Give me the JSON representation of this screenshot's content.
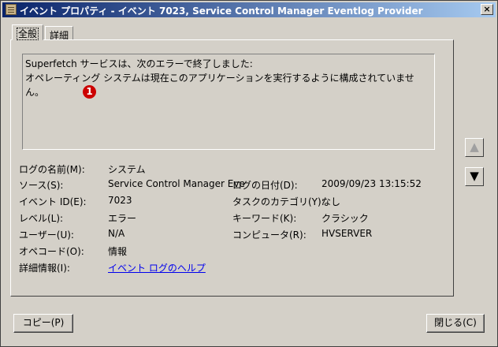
{
  "window": {
    "title": "イベント プロパティ - イベント 7023, Service Control Manager Eventlog Provider",
    "close": "×"
  },
  "tabs": [
    {
      "label": "全般"
    },
    {
      "label": "詳細"
    }
  ],
  "message": {
    "line1": "Superfetch サービスは、次のエラーで終了しました:",
    "line2": "オペレーティング システムは現在このアプリケーションを実行するように構成されていません。"
  },
  "annotation": {
    "marker": "1"
  },
  "fields": {
    "log_name": {
      "label": "ログの名前(M):",
      "value": "システム"
    },
    "source": {
      "label": "ソース(S):",
      "value": "Service Control Manager Eve"
    },
    "log_date": {
      "label": "ログの日付(D):",
      "value": "2009/09/23 13:15:52"
    },
    "event_id": {
      "label": "イベント ID(E):",
      "value": "7023"
    },
    "task_category": {
      "label": "タスクのカテゴリ(Y):",
      "value": "なし"
    },
    "level": {
      "label": "レベル(L):",
      "value": "エラー"
    },
    "keywords": {
      "label": "キーワード(K):",
      "value": "クラシック"
    },
    "user": {
      "label": "ユーザー(U):",
      "value": "N/A"
    },
    "computer": {
      "label": "コンピュータ(R):",
      "value": "HVSERVER"
    },
    "opcode": {
      "label": "オペコード(O):",
      "value": "情報"
    },
    "more_info": {
      "label": "詳細情報(I):",
      "value": "イベント ログのヘルプ"
    }
  },
  "buttons": {
    "copy": "コピー(P)",
    "close": "閉じる(C)",
    "up_icon": "arrow-up-icon",
    "down_icon": "arrow-down-icon"
  }
}
